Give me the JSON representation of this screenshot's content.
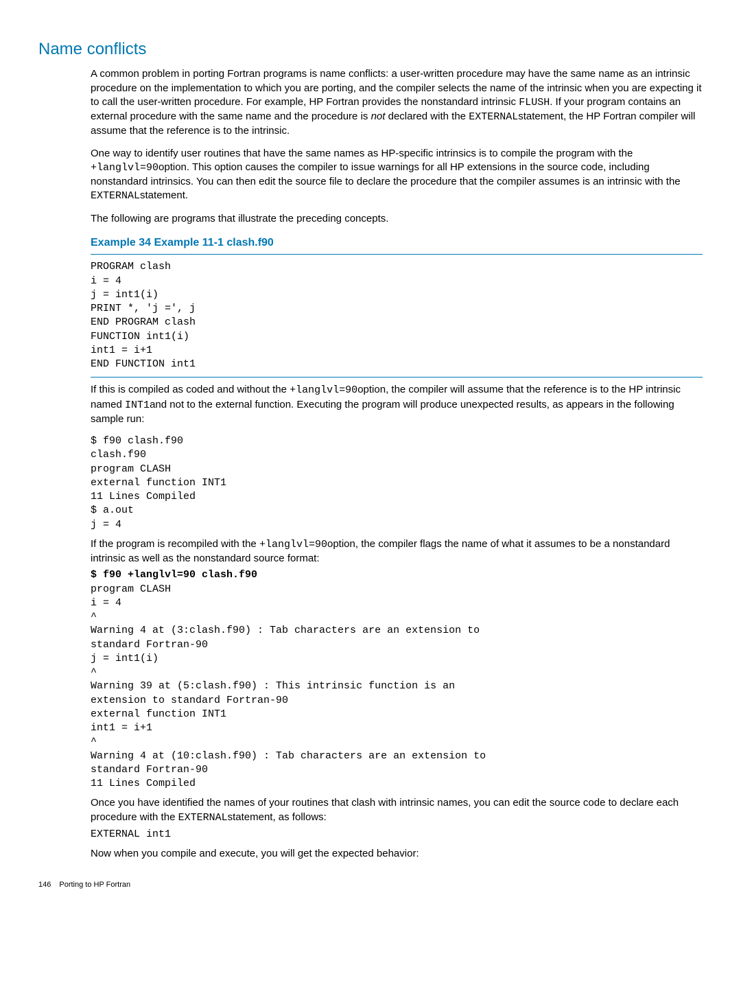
{
  "heading": "Name conflicts",
  "para1_a": "A common problem in porting Fortran programs is name conflicts: a user-written procedure may have the same name as an intrinsic procedure on the implementation to which you are porting, and the compiler selects the name of the intrinsic when you are expecting it to call the user-written procedure. For example, HP Fortran provides the nonstandard intrinsic ",
  "para1_code1": "FLUSH",
  "para1_b": ". If your program contains an external procedure with the same name and the procedure is ",
  "para1_em": "not",
  "para1_c": " declared with the ",
  "para1_code2": "EXTERNAL",
  "para1_d": "statement, the HP Fortran compiler will assume that the reference is to the intrinsic.",
  "para2_a": "One way to identify user routines that have the same names as HP-specific intrinsics is to compile the program with the ",
  "para2_code1": "+langlvl=90",
  "para2_b": "option. This option causes the compiler to issue warnings for all HP extensions in the source code, including nonstandard intrinsics. You can then edit the source file to declare the procedure that the compiler assumes is an intrinsic with the ",
  "para2_code2": "EXTERNAL",
  "para2_c": "statement.",
  "para3": "The following are programs that illustrate the preceding concepts.",
  "example_title": "Example 34 Example 11-1 clash.f90",
  "code_block1": "PROGRAM clash\ni = 4\nj = int1(i)\nPRINT *, 'j =', j\nEND PROGRAM clash\nFUNCTION int1(i)\nint1 = i+1\nEND FUNCTION int1",
  "para4_a": "If this is compiled as coded and without the ",
  "para4_code1": "+langlvl=90",
  "para4_b": "option, the compiler will assume that the reference is to the HP intrinsic named ",
  "para4_code2": "INT1",
  "para4_c": "and not to the external function. Executing the program will produce unexpected results, as appears in the following sample run:",
  "code_block2": "$ f90 clash.f90\nclash.f90\nprogram CLASH\nexternal function INT1\n11 Lines Compiled\n$ a.out\nj = 4",
  "para5_a": "If the program is recompiled with the ",
  "para5_code1": "+langlvl=90",
  "para5_b": "option, the compiler flags the name of what it assumes to be a nonstandard intrinsic as well as the nonstandard source format:",
  "code_block3_bold": "$ f90 +langlvl=90 clash.f90",
  "code_block3_rest": "program CLASH\ni = 4\n^\nWarning 4 at (3:clash.f90) : Tab characters are an extension to\nstandard Fortran-90\nj = int1(i)\n^\nWarning 39 at (5:clash.f90) : This intrinsic function is an\nextension to standard Fortran-90\nexternal function INT1\nint1 = i+1\n^\nWarning 4 at (10:clash.f90) : Tab characters are an extension to\nstandard Fortran-90\n11 Lines Compiled",
  "para6_a": "Once you have identified the names of your routines that clash with intrinsic names, you can edit the source code to declare each procedure with the ",
  "para6_code1": "EXTERNAL",
  "para6_b": "statement, as follows:",
  "code_block4": "EXTERNAL int1",
  "para7": "Now when you compile and execute, you will get the expected behavior:",
  "footer_page": "146",
  "footer_text": "Porting to HP Fortran"
}
